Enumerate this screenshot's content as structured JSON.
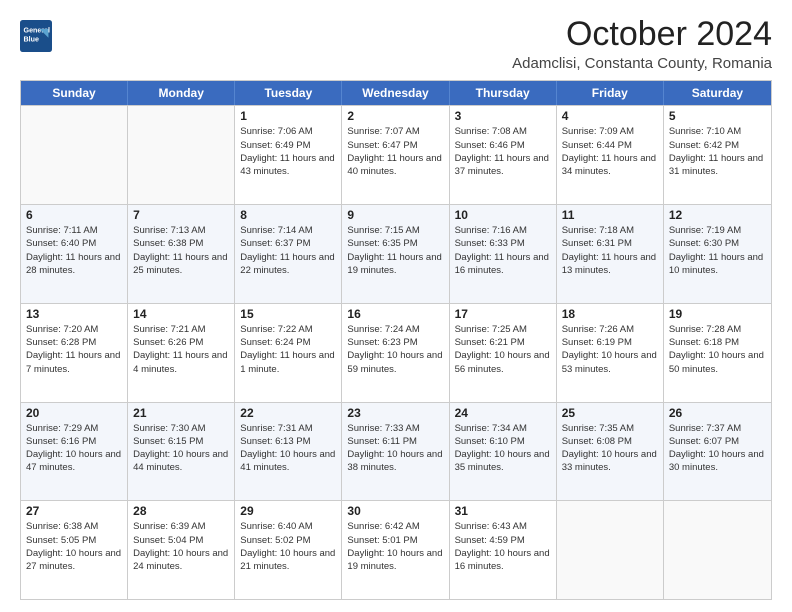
{
  "header": {
    "logo_line1": "General",
    "logo_line2": "Blue",
    "month": "October 2024",
    "location": "Adamclisi, Constanta County, Romania"
  },
  "weekdays": [
    "Sunday",
    "Monday",
    "Tuesday",
    "Wednesday",
    "Thursday",
    "Friday",
    "Saturday"
  ],
  "weeks": [
    [
      {
        "day": "",
        "empty": true
      },
      {
        "day": "",
        "empty": true
      },
      {
        "day": "1",
        "sunrise": "Sunrise: 7:06 AM",
        "sunset": "Sunset: 6:49 PM",
        "daylight": "Daylight: 11 hours and 43 minutes."
      },
      {
        "day": "2",
        "sunrise": "Sunrise: 7:07 AM",
        "sunset": "Sunset: 6:47 PM",
        "daylight": "Daylight: 11 hours and 40 minutes."
      },
      {
        "day": "3",
        "sunrise": "Sunrise: 7:08 AM",
        "sunset": "Sunset: 6:46 PM",
        "daylight": "Daylight: 11 hours and 37 minutes."
      },
      {
        "day": "4",
        "sunrise": "Sunrise: 7:09 AM",
        "sunset": "Sunset: 6:44 PM",
        "daylight": "Daylight: 11 hours and 34 minutes."
      },
      {
        "day": "5",
        "sunrise": "Sunrise: 7:10 AM",
        "sunset": "Sunset: 6:42 PM",
        "daylight": "Daylight: 11 hours and 31 minutes."
      }
    ],
    [
      {
        "day": "6",
        "sunrise": "Sunrise: 7:11 AM",
        "sunset": "Sunset: 6:40 PM",
        "daylight": "Daylight: 11 hours and 28 minutes."
      },
      {
        "day": "7",
        "sunrise": "Sunrise: 7:13 AM",
        "sunset": "Sunset: 6:38 PM",
        "daylight": "Daylight: 11 hours and 25 minutes."
      },
      {
        "day": "8",
        "sunrise": "Sunrise: 7:14 AM",
        "sunset": "Sunset: 6:37 PM",
        "daylight": "Daylight: 11 hours and 22 minutes."
      },
      {
        "day": "9",
        "sunrise": "Sunrise: 7:15 AM",
        "sunset": "Sunset: 6:35 PM",
        "daylight": "Daylight: 11 hours and 19 minutes."
      },
      {
        "day": "10",
        "sunrise": "Sunrise: 7:16 AM",
        "sunset": "Sunset: 6:33 PM",
        "daylight": "Daylight: 11 hours and 16 minutes."
      },
      {
        "day": "11",
        "sunrise": "Sunrise: 7:18 AM",
        "sunset": "Sunset: 6:31 PM",
        "daylight": "Daylight: 11 hours and 13 minutes."
      },
      {
        "day": "12",
        "sunrise": "Sunrise: 7:19 AM",
        "sunset": "Sunset: 6:30 PM",
        "daylight": "Daylight: 11 hours and 10 minutes."
      }
    ],
    [
      {
        "day": "13",
        "sunrise": "Sunrise: 7:20 AM",
        "sunset": "Sunset: 6:28 PM",
        "daylight": "Daylight: 11 hours and 7 minutes."
      },
      {
        "day": "14",
        "sunrise": "Sunrise: 7:21 AM",
        "sunset": "Sunset: 6:26 PM",
        "daylight": "Daylight: 11 hours and 4 minutes."
      },
      {
        "day": "15",
        "sunrise": "Sunrise: 7:22 AM",
        "sunset": "Sunset: 6:24 PM",
        "daylight": "Daylight: 11 hours and 1 minute."
      },
      {
        "day": "16",
        "sunrise": "Sunrise: 7:24 AM",
        "sunset": "Sunset: 6:23 PM",
        "daylight": "Daylight: 10 hours and 59 minutes."
      },
      {
        "day": "17",
        "sunrise": "Sunrise: 7:25 AM",
        "sunset": "Sunset: 6:21 PM",
        "daylight": "Daylight: 10 hours and 56 minutes."
      },
      {
        "day": "18",
        "sunrise": "Sunrise: 7:26 AM",
        "sunset": "Sunset: 6:19 PM",
        "daylight": "Daylight: 10 hours and 53 minutes."
      },
      {
        "day": "19",
        "sunrise": "Sunrise: 7:28 AM",
        "sunset": "Sunset: 6:18 PM",
        "daylight": "Daylight: 10 hours and 50 minutes."
      }
    ],
    [
      {
        "day": "20",
        "sunrise": "Sunrise: 7:29 AM",
        "sunset": "Sunset: 6:16 PM",
        "daylight": "Daylight: 10 hours and 47 minutes."
      },
      {
        "day": "21",
        "sunrise": "Sunrise: 7:30 AM",
        "sunset": "Sunset: 6:15 PM",
        "daylight": "Daylight: 10 hours and 44 minutes."
      },
      {
        "day": "22",
        "sunrise": "Sunrise: 7:31 AM",
        "sunset": "Sunset: 6:13 PM",
        "daylight": "Daylight: 10 hours and 41 minutes."
      },
      {
        "day": "23",
        "sunrise": "Sunrise: 7:33 AM",
        "sunset": "Sunset: 6:11 PM",
        "daylight": "Daylight: 10 hours and 38 minutes."
      },
      {
        "day": "24",
        "sunrise": "Sunrise: 7:34 AM",
        "sunset": "Sunset: 6:10 PM",
        "daylight": "Daylight: 10 hours and 35 minutes."
      },
      {
        "day": "25",
        "sunrise": "Sunrise: 7:35 AM",
        "sunset": "Sunset: 6:08 PM",
        "daylight": "Daylight: 10 hours and 33 minutes."
      },
      {
        "day": "26",
        "sunrise": "Sunrise: 7:37 AM",
        "sunset": "Sunset: 6:07 PM",
        "daylight": "Daylight: 10 hours and 30 minutes."
      }
    ],
    [
      {
        "day": "27",
        "sunrise": "Sunrise: 6:38 AM",
        "sunset": "Sunset: 5:05 PM",
        "daylight": "Daylight: 10 hours and 27 minutes."
      },
      {
        "day": "28",
        "sunrise": "Sunrise: 6:39 AM",
        "sunset": "Sunset: 5:04 PM",
        "daylight": "Daylight: 10 hours and 24 minutes."
      },
      {
        "day": "29",
        "sunrise": "Sunrise: 6:40 AM",
        "sunset": "Sunset: 5:02 PM",
        "daylight": "Daylight: 10 hours and 21 minutes."
      },
      {
        "day": "30",
        "sunrise": "Sunrise: 6:42 AM",
        "sunset": "Sunset: 5:01 PM",
        "daylight": "Daylight: 10 hours and 19 minutes."
      },
      {
        "day": "31",
        "sunrise": "Sunrise: 6:43 AM",
        "sunset": "Sunset: 4:59 PM",
        "daylight": "Daylight: 10 hours and 16 minutes."
      },
      {
        "day": "",
        "empty": true
      },
      {
        "day": "",
        "empty": true
      }
    ]
  ]
}
